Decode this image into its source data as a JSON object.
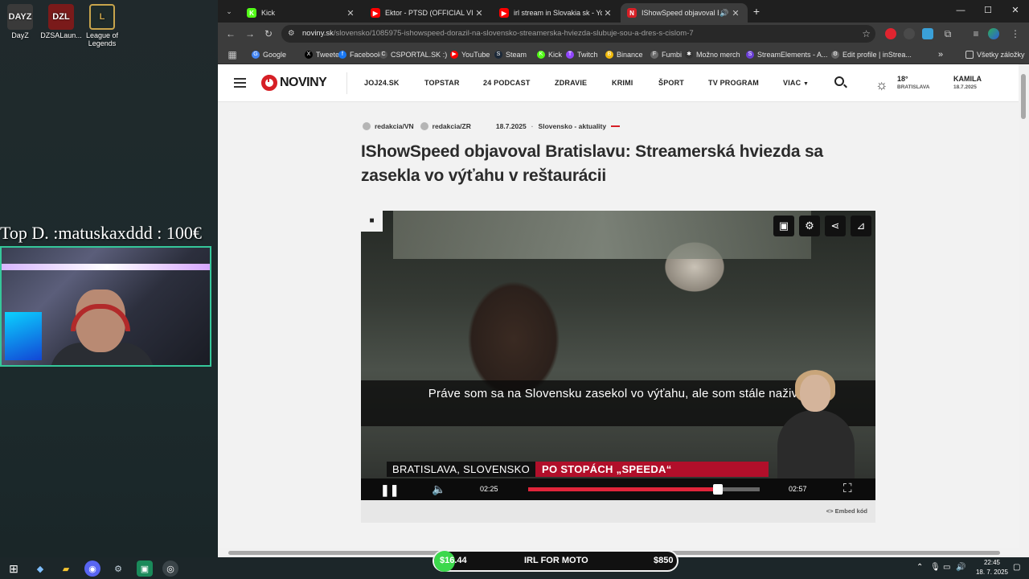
{
  "desktop": {
    "icons": [
      {
        "label": "DayZ",
        "badge": "DAYZ"
      },
      {
        "label": "DZSALaun...",
        "badge": "DZL"
      },
      {
        "label": "League of Legends",
        "badge": "L"
      }
    ],
    "donation_text": "Top D. :matuskaxddd : 100€"
  },
  "browser": {
    "tabs": [
      {
        "title": "Kick",
        "color": "#53fc18",
        "letter": "K"
      },
      {
        "title": "Ektor - PTSD (OFFICIAL VIDEO)",
        "color": "#ff0000",
        "letter": "▶"
      },
      {
        "title": "irl stream in Slovakia sk - YouTu",
        "color": "#ff0000",
        "letter": "▶"
      },
      {
        "title": "IShowSpeed objavoval Brati",
        "color": "#d61f26",
        "letter": "N",
        "active": true
      }
    ],
    "new_tab": "+",
    "window_controls": [
      "—",
      "☐",
      "✕"
    ],
    "address": {
      "host": "noviny.sk",
      "path": "/slovensko/1085975-ishowspeed-dorazil-na-slovensko-streamerska-hviezda-slubuje-sou-a-dres-s-cislom-7"
    },
    "bookmarks": [
      {
        "label": "Google",
        "color": "#4285f4",
        "glyph": "G"
      },
      {
        "label": "Tweeter",
        "color": "#000000",
        "glyph": "X"
      },
      {
        "label": "Facebook",
        "color": "#1877f2",
        "glyph": "f"
      },
      {
        "label": "CSPORTAL.SK :)",
        "color": "#555555",
        "glyph": "C"
      },
      {
        "label": "YouTube",
        "color": "#ff0000",
        "glyph": "▶"
      },
      {
        "label": "Steam",
        "color": "#1b2838",
        "glyph": "S"
      },
      {
        "label": "Kick",
        "color": "#53fc18",
        "glyph": "K"
      },
      {
        "label": "Twitch",
        "color": "#9146ff",
        "glyph": "T"
      },
      {
        "label": "Binance",
        "color": "#f0b90b",
        "glyph": "B"
      },
      {
        "label": "Fumbi",
        "color": "#6a6a6a",
        "glyph": "F"
      },
      {
        "label": "Možno merch",
        "color": "#333333",
        "glyph": "✱"
      },
      {
        "label": "StreamElements - A...",
        "color": "#6b3fd6",
        "glyph": "S"
      },
      {
        "label": "Edit profile | inStrea...",
        "color": "#666666",
        "glyph": "⚙"
      }
    ],
    "bookmarks_more": "»",
    "all_bookmarks": "Všetky záložky"
  },
  "site": {
    "logo": "NOVINY",
    "nav": [
      "JOJ24.SK",
      "TOPSTAR",
      "24 PODCAST",
      "ZDRAVIE",
      "KRIMI",
      "ŠPORT",
      "TV PROGRAM",
      "VIAC"
    ],
    "weather": {
      "temp": "18°",
      "city": "BRATISLAVA"
    },
    "nameday": {
      "name": "KAMILA",
      "date": "18.7.2025"
    }
  },
  "article": {
    "authors": [
      "redakcia/VN",
      "redakcia/ZR"
    ],
    "date": "18.7.2025",
    "category": "Slovensko - aktuality",
    "title": "IShowSpeed objavoval Bratislavu: Streamerská hviezda sa zasekla vo výťahu v reštaurácii",
    "embed_label": "Embed kód"
  },
  "video": {
    "subtitle": "Práve som sa na Slovensku zasekol vo výťahu, ale som stále nažive!",
    "lower_third_location": "BRATISLAVA, SLOVENSKO",
    "lower_third_show": "PO STOPÁCH „SPEEDA“",
    "current_time": "02:25",
    "duration": "02:57",
    "progress": 0.819
  },
  "overlay_goal": {
    "current": "$16.44",
    "label": "IRL FOR MOTO",
    "target": "$850",
    "progress": 0.019
  },
  "taskbar": {
    "time": "22:45",
    "date": "18. 7. 2025"
  }
}
